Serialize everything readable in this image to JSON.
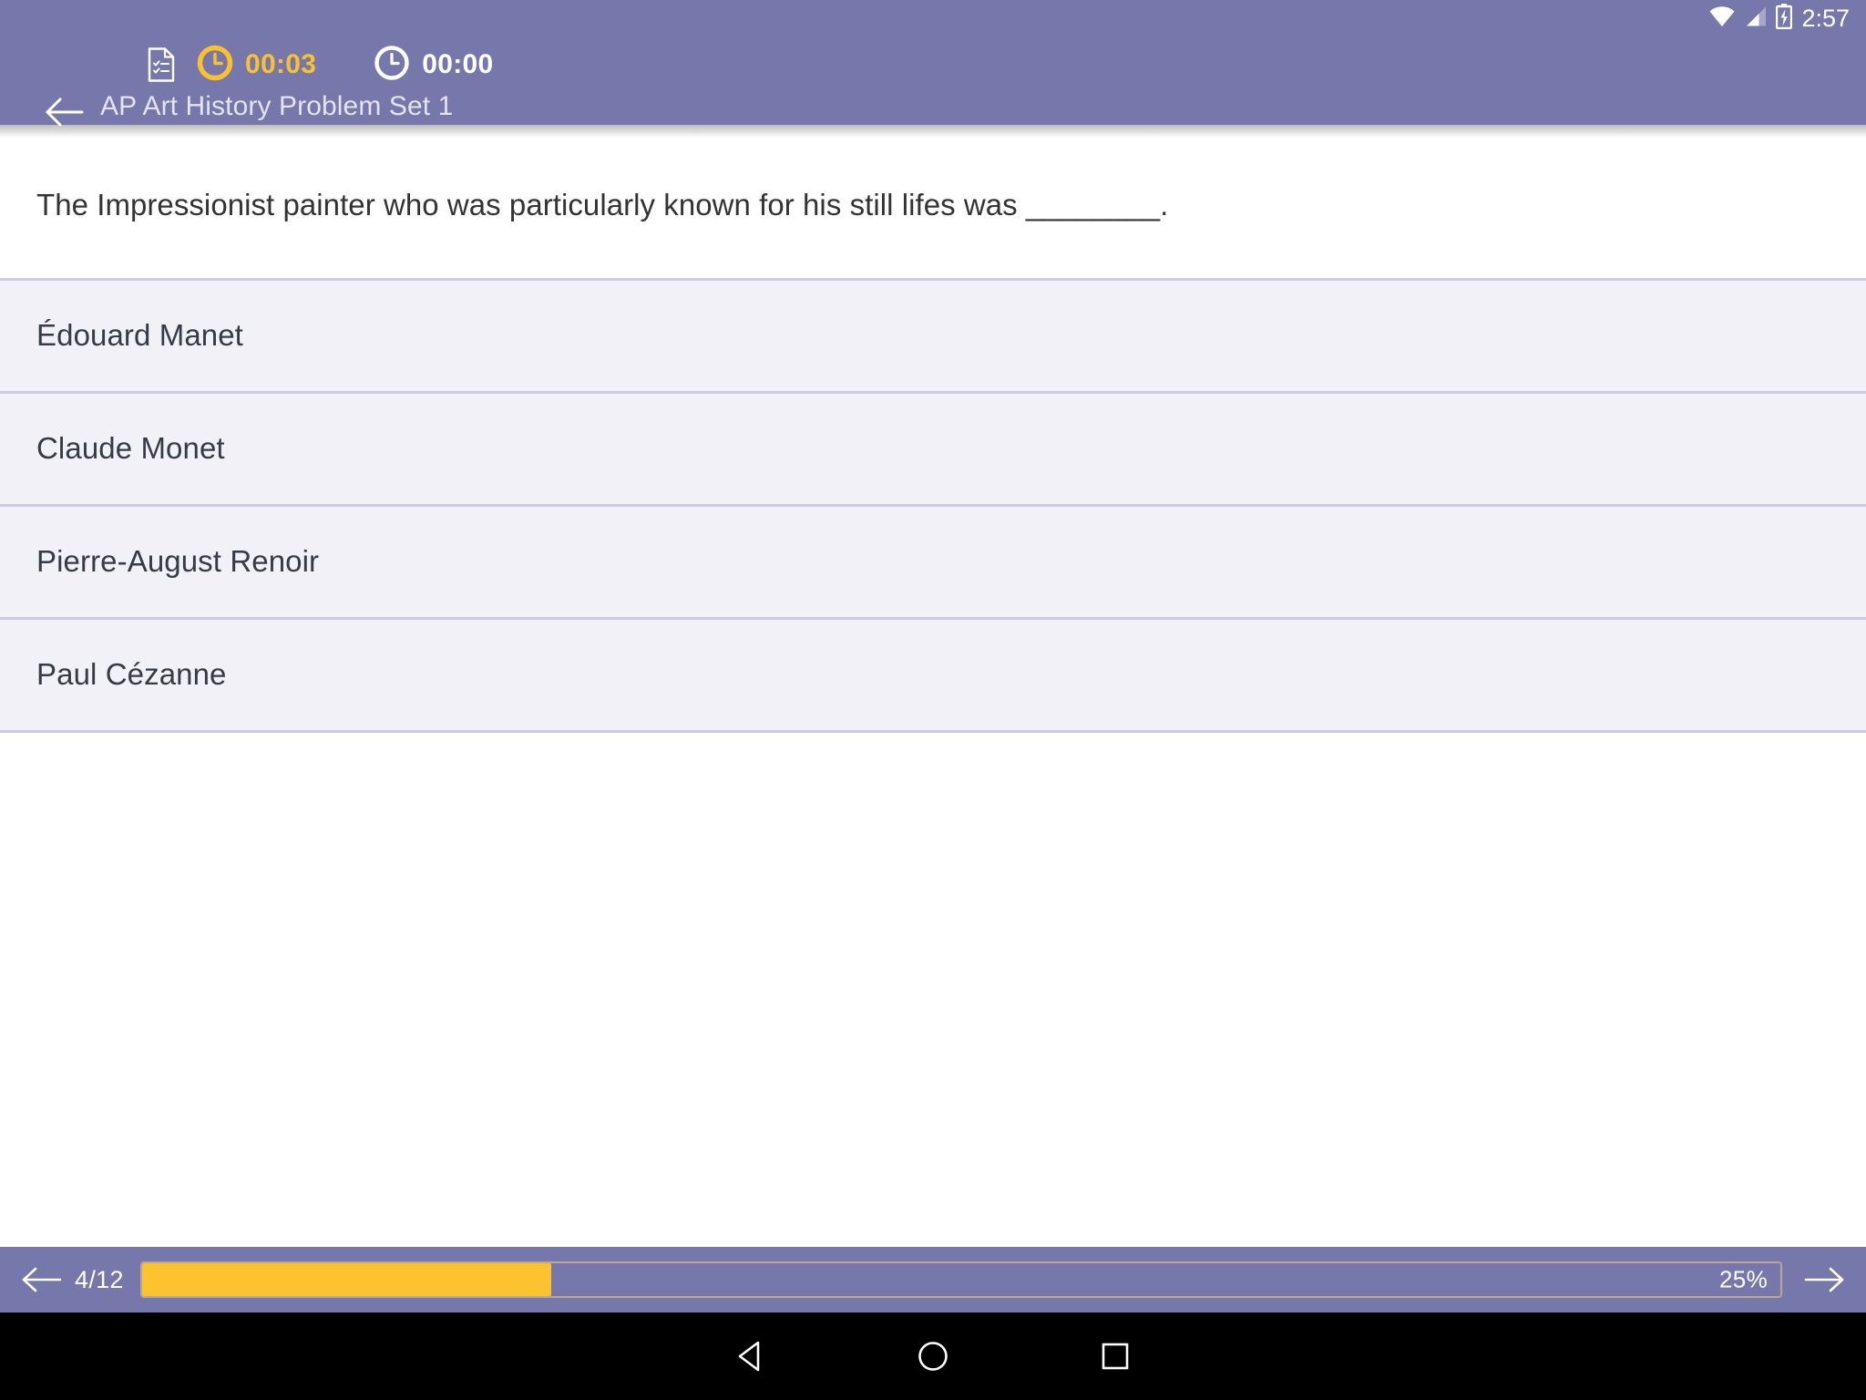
{
  "status_bar": {
    "time": "2:57",
    "icons": [
      "wifi-icon",
      "cell-signal-icon",
      "battery-charging-icon"
    ]
  },
  "header": {
    "background_color": "#7678ac",
    "back_icon": "back-arrow-icon",
    "document_icon": "document-checklist-icon",
    "title": "AP Art History Problem Set 1",
    "timers": [
      {
        "icon": "clock-icon",
        "value": "00:03",
        "color": "#fbc02d"
      },
      {
        "icon": "clock-icon",
        "value": "00:00",
        "color": "#ffffff"
      }
    ]
  },
  "question": {
    "text": "The Impressionist painter who was particularly known for his still lifes was ________."
  },
  "options": [
    {
      "label": "Édouard Manet"
    },
    {
      "label": "Claude Monet"
    },
    {
      "label": "Pierre-August Renoir"
    },
    {
      "label": "Paul Cézanne"
    }
  ],
  "bottom_bar": {
    "prev_icon": "left-arrow-icon",
    "next_icon": "right-arrow-icon",
    "progress_count": "4/12",
    "progress_percent_label": "25%",
    "progress_percent_value": 25,
    "fill_color": "#fcc331",
    "track_border_color": "#b9a896"
  },
  "android_nav": {
    "back_icon": "triangle-back-icon",
    "home_icon": "circle-home-icon",
    "recents_icon": "square-recents-icon"
  }
}
